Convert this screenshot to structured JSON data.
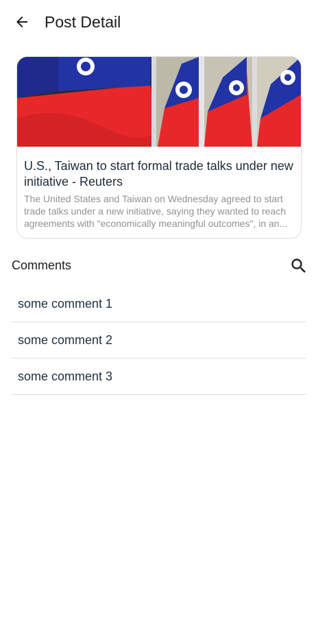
{
  "app_bar": {
    "title": "Post Detail",
    "back_icon": "arrow-left-icon"
  },
  "post": {
    "image_description_icon": "flag-photo",
    "title": "U.S., Taiwan to start formal trade talks under new initiative - Reuters",
    "description": "The United States and Taiwan on Wednesday agreed to start trade talks under a new initiative, saying they wanted to reach agreements with \"economically meaningful outcomes\", in an..."
  },
  "comments": {
    "header": "Comments",
    "search_icon": "search-icon",
    "items": [
      {
        "text": "some comment 1"
      },
      {
        "text": "some comment 2"
      },
      {
        "text": "some comment 3"
      }
    ]
  },
  "colors": {
    "flag_red": "#e8272a",
    "flag_blue": "#2333a8",
    "divider": "#dedfe2",
    "description_text": "#8f9295"
  }
}
